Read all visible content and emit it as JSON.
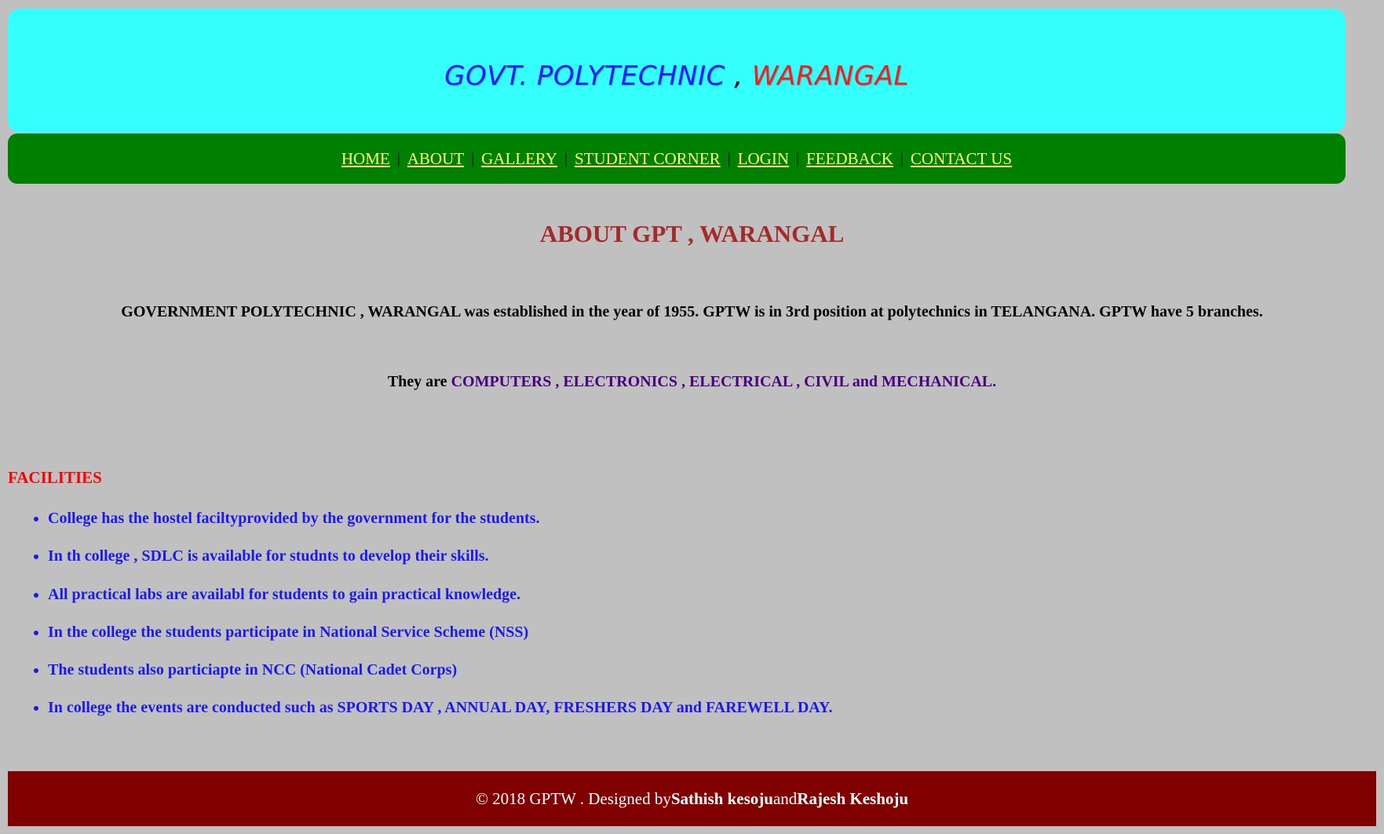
{
  "header": {
    "title_main": "GOVT. POLYTECHNIC",
    "title_sep": " , ",
    "title_city": "WARANGAL"
  },
  "nav": {
    "items": [
      {
        "label": "HOME "
      },
      {
        "label": "ABOUT "
      },
      {
        "label": "GALLERY"
      },
      {
        "label": "STUDENT CORNER"
      },
      {
        "label": "LOGIN"
      },
      {
        "label": "FEEDBACK"
      },
      {
        "label": "CONTACT US"
      }
    ],
    "separator": "|"
  },
  "about": {
    "heading": "ABOUT GPT , WARANGAL",
    "paragraph": "GOVERNMENT POLYTECHNIC , WARANGAL was established in the year of 1955. GPTW is in 3rd position at polytechnics in TELANGANA. GPTW have 5 branches.",
    "branches_lead": "They are ",
    "branches_list": "COMPUTERS , ELECTRONICS , ELECTRICAL , CIVIL and MECHANICAL."
  },
  "facilities": {
    "heading": "FACILITIES",
    "items": [
      "College has the hostel faciltyprovided by the government for the students.",
      "In th college , SDLC is available for studnts to develop their skills.",
      "All practical labs are availabl for students to gain practical knowledge.",
      "In the college the students participate in National Service Scheme (NSS)",
      "The students also particiapte in NCC (National Cadet Corps)",
      "In college the events are conducted such as SPORTS DAY , ANNUAL DAY, FRESHERS DAY and FAREWELL DAY."
    ]
  },
  "footer": {
    "prefix": "© 2018 GPTW . Designed by ",
    "author1": "Sathish kesoju",
    "joiner": " and ",
    "author2": "Rajesh Keshoju"
  },
  "colors": {
    "header_bg": "#33ffff",
    "nav_bg": "#008000",
    "nav_link": "#ffff66",
    "page_bg": "#c0c0c0",
    "about_heading": "#a52a2a",
    "branches": "#4b0082",
    "facilities_heading": "#ff0000",
    "facilities_text": "#1a1aee",
    "footer_bg": "#800000"
  }
}
